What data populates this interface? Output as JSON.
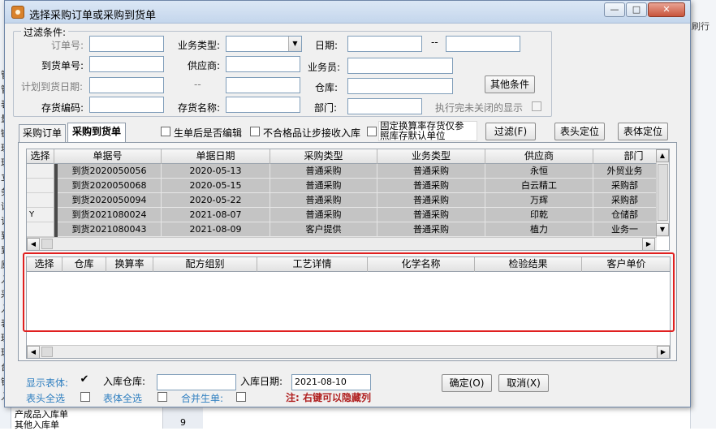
{
  "background": {
    "right_tab": "刷行",
    "bottom_items": [
      "产成品入库单",
      "其他入库单"
    ],
    "row_number": "9",
    "left_chars": [
      "管",
      "管",
      "表",
      "量",
      "链",
      "理",
      "理",
      "立",
      "务",
      "请",
      "订",
      "到",
      "到",
      "原",
      "入",
      "采",
      "入",
      "表",
      "理",
      "理",
      "台",
      "销",
      "入"
    ]
  },
  "dialog": {
    "title": "选择采购订单或采购到货单",
    "window_buttons": {
      "min": "—",
      "max": "□",
      "close": "✕"
    }
  },
  "filter": {
    "legend": "过滤条件:",
    "order_no_label": "订单号:",
    "order_no_value": "",
    "biz_type_label": "业务类型:",
    "biz_type_value": "",
    "date_label": "日期:",
    "date_from": "",
    "date_sep": "--",
    "date_to": "",
    "arrival_no_label": "到货单号:",
    "arrival_no_value": "",
    "supplier_label": "供应商:",
    "supplier_value": "",
    "salesman_label": "业务员:",
    "salesman_value": "",
    "planned_date_label": "计划到货日期:",
    "planned_date_from": "",
    "planned_date_sep": "--",
    "planned_date_to": "",
    "warehouse_label": "仓库:",
    "warehouse_value": "",
    "other_conditions_button": "其他条件",
    "inventory_code_label": "存货编码:",
    "inventory_code_value": "",
    "inventory_name_label": "存货名称:",
    "inventory_name_value": "",
    "dept_label": "部门:",
    "dept_value": "",
    "show_closed_label": "执行完未关闭的显示"
  },
  "toolbar": {
    "tab_purchase_order": "采购订单",
    "tab_arrival": "采购到货单",
    "editable_after_generate": "生单后是否编辑",
    "reject_step_in": "不合格品让步接收入库",
    "fixed_rate_line1": "固定换算率存货仅参",
    "fixed_rate_line2": "照库存默认单位",
    "filter_button": "过滤(F)",
    "header_locate_button": "表头定位",
    "body_locate_button": "表体定位"
  },
  "upper_grid": {
    "columns": [
      "选择",
      "单据号",
      "单据日期",
      "采购类型",
      "业务类型",
      "供应商",
      "部门"
    ],
    "rows": [
      {
        "selected": "",
        "doc_no": "到货2020050056",
        "date": "2020-05-13",
        "purchase_type": "普通采购",
        "biz_type": "普通采购",
        "supplier": "永恒",
        "dept": "外贸业务"
      },
      {
        "selected": "",
        "doc_no": "到货2020050068",
        "date": "2020-05-15",
        "purchase_type": "普通采购",
        "biz_type": "普通采购",
        "supplier": "白云精工",
        "dept": "采购部"
      },
      {
        "selected": "",
        "doc_no": "到货2020050094",
        "date": "2020-05-22",
        "purchase_type": "普通采购",
        "biz_type": "普通采购",
        "supplier": "万辉",
        "dept": "采购部"
      },
      {
        "selected": "Y",
        "doc_no": "到货2021080024",
        "date": "2021-08-07",
        "purchase_type": "普通采购",
        "biz_type": "普通采购",
        "supplier": "印乾",
        "dept": "仓储部"
      },
      {
        "selected": "",
        "doc_no": "到货2021080043",
        "date": "2021-08-09",
        "purchase_type": "客户提供",
        "biz_type": "普通采购",
        "supplier": "植力",
        "dept": "业务一"
      }
    ]
  },
  "lower_grid": {
    "columns": [
      "选择",
      "仓库",
      "换算率",
      "配方组别",
      "工艺详情",
      "化学名称",
      "检验结果",
      "客户单价"
    ]
  },
  "footer": {
    "show_body_label": "显示表体:",
    "in_warehouse_label": "入库仓库:",
    "in_warehouse_value": "",
    "in_date_label": "入库日期:",
    "in_date_value": "2021-08-10",
    "ok_button": "确定(O)",
    "cancel_button": "取消(X)",
    "header_select_all": "表头全选",
    "body_select_all": "表体全选",
    "merge_generate": "合并生单:",
    "note": "注: 右键可以隐藏列"
  }
}
